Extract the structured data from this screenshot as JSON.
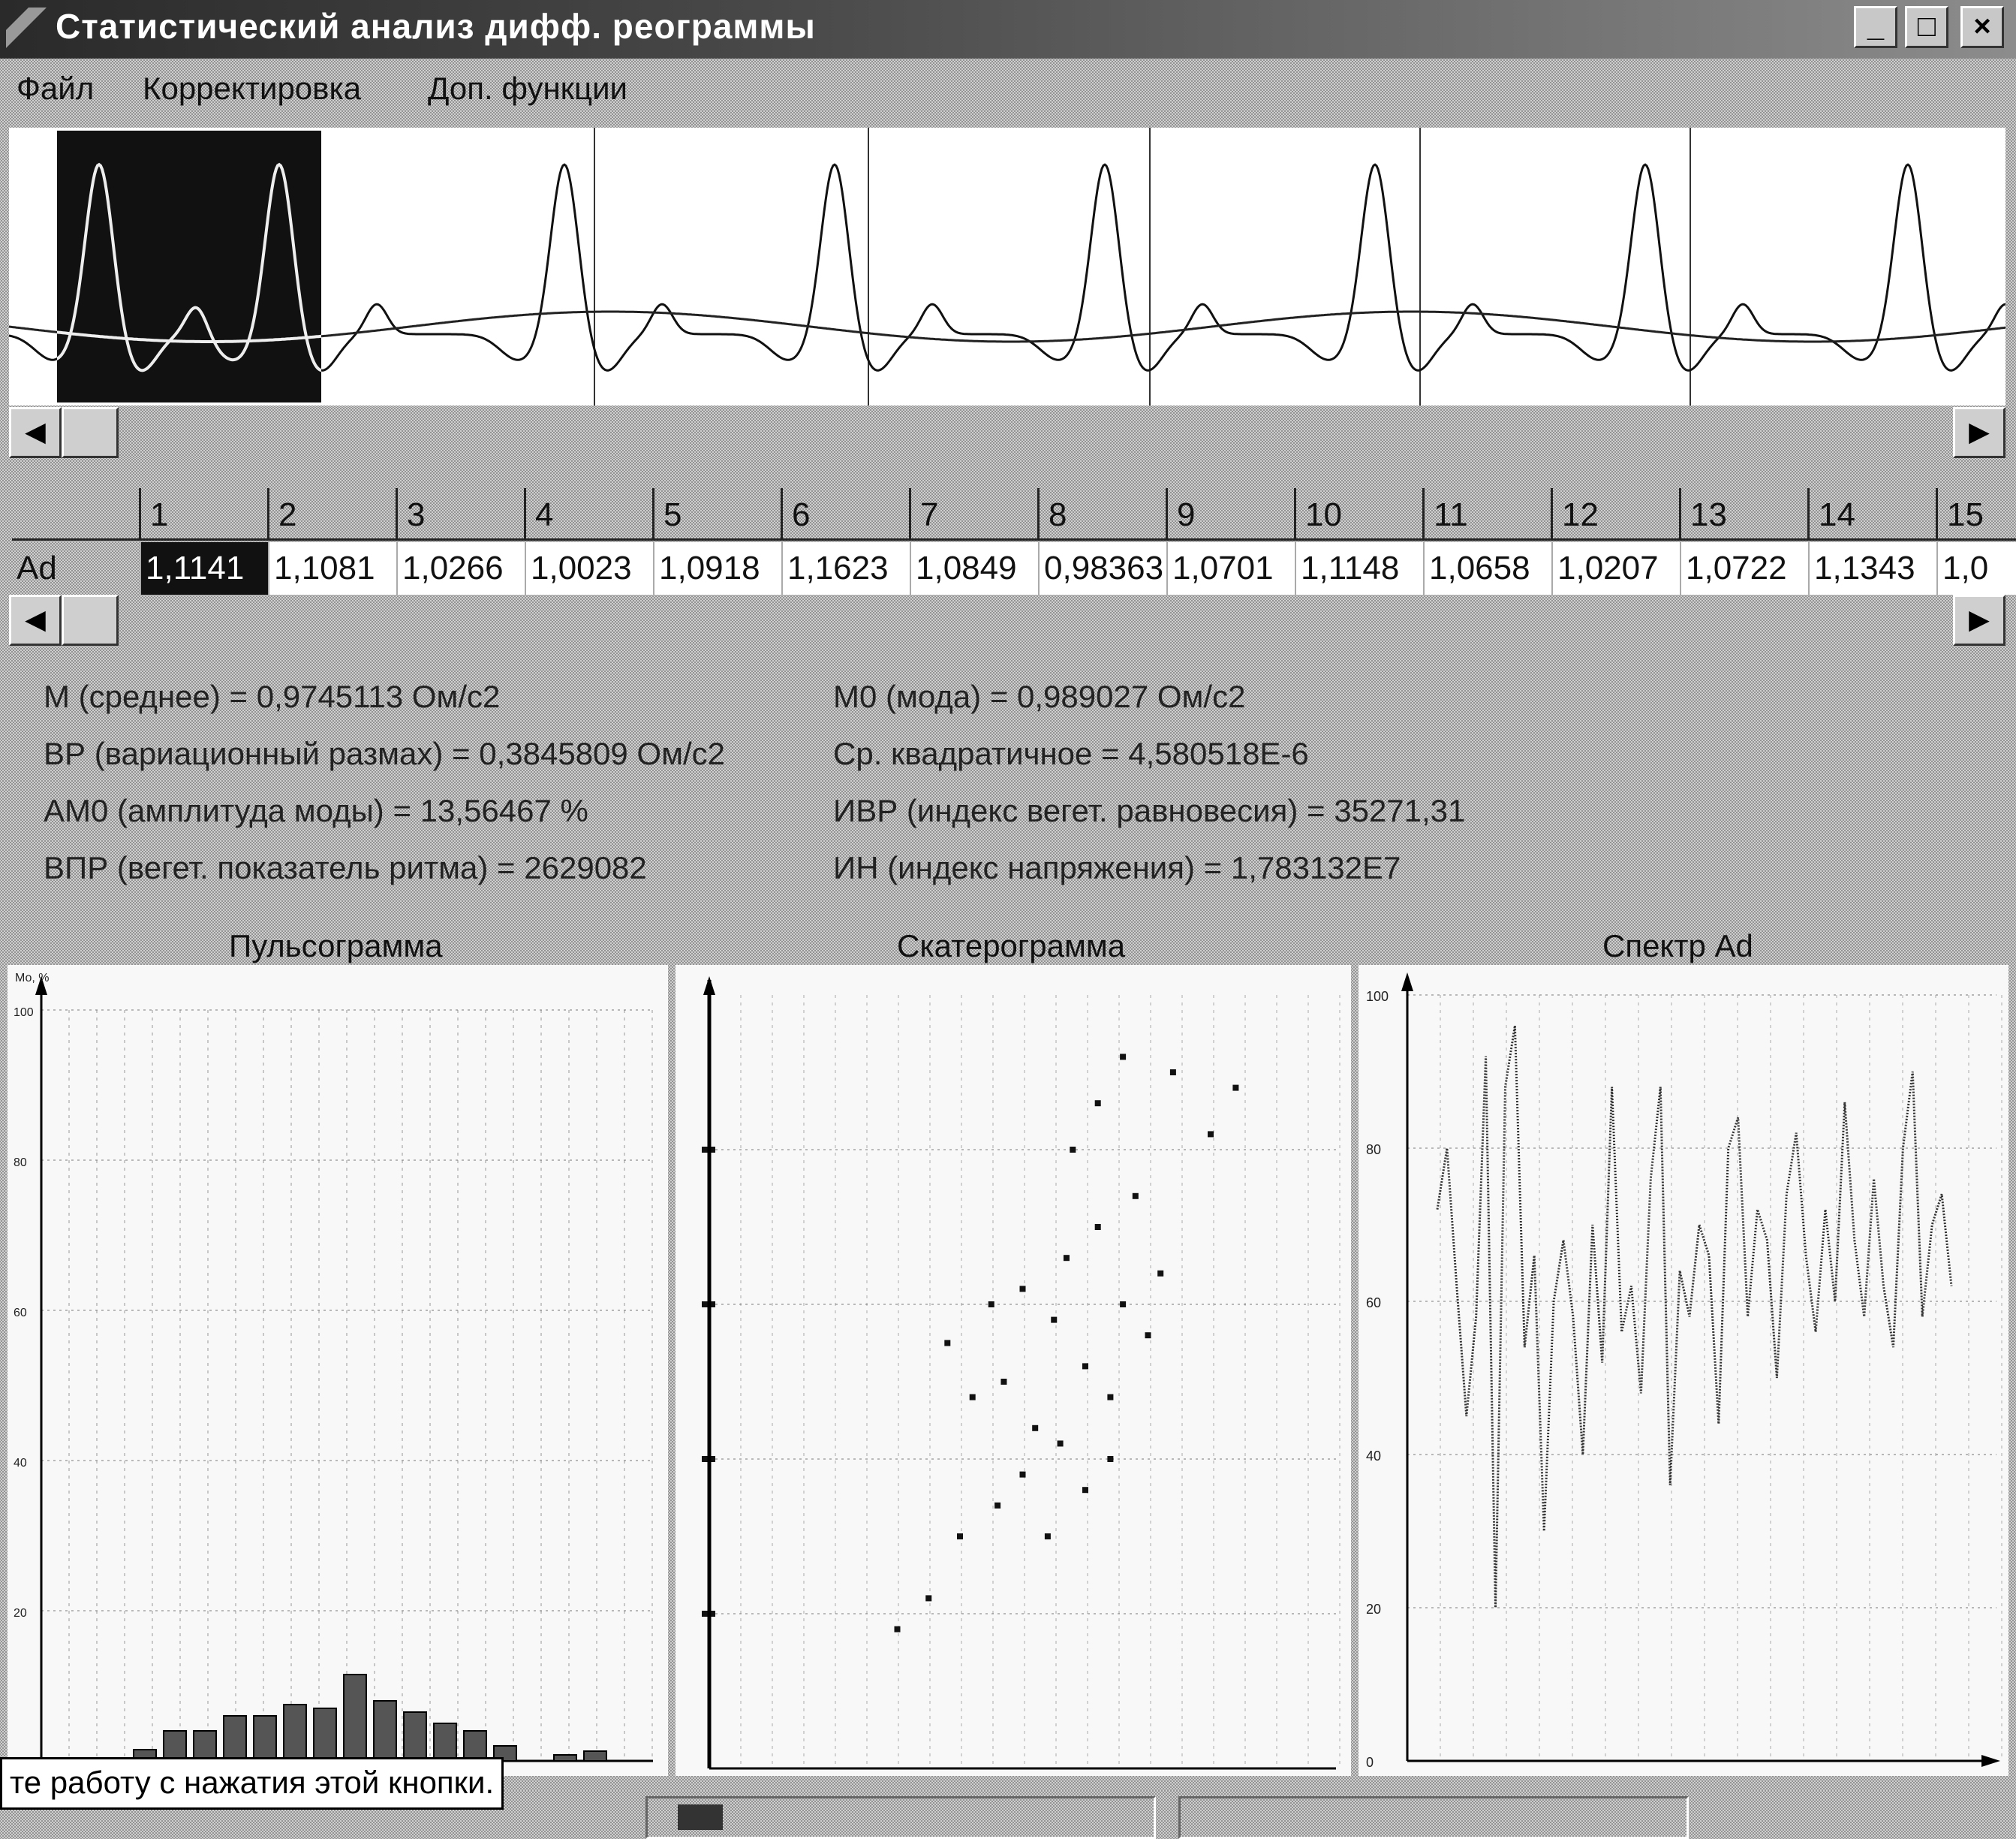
{
  "window": {
    "title": "Статистический анализ дифф. реограммы",
    "minimize_glyph": "_",
    "maximize_glyph": "□",
    "close_glyph": "×"
  },
  "menu": {
    "items": [
      "Файл",
      "Корректировка",
      "Доп. функции"
    ]
  },
  "scroll": {
    "left_arrow": "◀",
    "right_arrow": "▶"
  },
  "table": {
    "row_label": "Ad",
    "columns": [
      "1",
      "2",
      "3",
      "4",
      "5",
      "6",
      "7",
      "8",
      "9",
      "10",
      "11",
      "12",
      "13",
      "14",
      "15"
    ],
    "values": [
      "1,1141",
      "1,1081",
      "1,0266",
      "1,0023",
      "1,0918",
      "1,1623",
      "1,0849",
      "0,98363",
      "1,0701",
      "1,1148",
      "1,0658",
      "1,0207",
      "1,0722",
      "1,1343",
      "1,0"
    ]
  },
  "stats": {
    "left": [
      "М (среднее) = 0,9745113 Ом/с2",
      "ВР (вариационный размах) = 0,3845809 Ом/с2",
      "АМ0 (амплитуда моды) = 13,56467 %",
      "ВПР (вегет. показатель ритма) = 2629082"
    ],
    "right": [
      "М0 (мода) = 0,989027 Ом/с2",
      "Ср. квадратичное = 4,580518E-6",
      "ИВР (индекс вегет. равновесия) = 35271,31",
      "ИН (индекс напряжения) = 1,783132E7"
    ]
  },
  "charts": {
    "pulsogram": {
      "title": "Пульсограмма",
      "axis_label": "Мо, %",
      "yticks": [
        "100",
        "80",
        "60",
        "40",
        "20"
      ]
    },
    "scattergram": {
      "title": "Скатерограмма"
    },
    "spectrum": {
      "title": "Спектр Ad",
      "yticks": [
        "100",
        "80",
        "60",
        "40",
        "20",
        "0"
      ]
    }
  },
  "chart_data": [
    {
      "type": "bar",
      "title": "Пульсограмма",
      "ylabel": "Мо, %",
      "ylim": [
        0,
        100
      ],
      "values": [
        1.5,
        4,
        4,
        6,
        6,
        7.5,
        7,
        11.5,
        8,
        6.5,
        5,
        4,
        2,
        0,
        0.8,
        1.3
      ]
    },
    {
      "type": "scatter",
      "title": "Скатерограмма",
      "points": [
        [
          0.38,
          0.55
        ],
        [
          0.42,
          0.48
        ],
        [
          0.45,
          0.6
        ],
        [
          0.47,
          0.5
        ],
        [
          0.5,
          0.62
        ],
        [
          0.52,
          0.44
        ],
        [
          0.55,
          0.58
        ],
        [
          0.57,
          0.66
        ],
        [
          0.6,
          0.52
        ],
        [
          0.62,
          0.7
        ],
        [
          0.64,
          0.48
        ],
        [
          0.66,
          0.6
        ],
        [
          0.68,
          0.74
        ],
        [
          0.7,
          0.56
        ],
        [
          0.72,
          0.64
        ],
        [
          0.5,
          0.38
        ],
        [
          0.46,
          0.34
        ],
        [
          0.4,
          0.3
        ],
        [
          0.35,
          0.22
        ],
        [
          0.3,
          0.18
        ],
        [
          0.58,
          0.8
        ],
        [
          0.62,
          0.86
        ],
        [
          0.66,
          0.92
        ],
        [
          0.74,
          0.9
        ],
        [
          0.8,
          0.82
        ],
        [
          0.84,
          0.88
        ],
        [
          0.56,
          0.42
        ],
        [
          0.6,
          0.36
        ],
        [
          0.64,
          0.4
        ],
        [
          0.54,
          0.3
        ]
      ]
    },
    {
      "type": "line",
      "title": "Спектр Ad",
      "ylim": [
        0,
        100
      ],
      "values": [
        72,
        80,
        62,
        45,
        58,
        92,
        20,
        88,
        96,
        54,
        66,
        30,
        60,
        68,
        58,
        40,
        70,
        52,
        88,
        56,
        62,
        48,
        76,
        88,
        36,
        64,
        58,
        70,
        66,
        44,
        80,
        84,
        58,
        72,
        68,
        50,
        74,
        82,
        66,
        56,
        72,
        60,
        86,
        68,
        58,
        76,
        62,
        54,
        80,
        90,
        58,
        70,
        74,
        62
      ]
    }
  ]
}
